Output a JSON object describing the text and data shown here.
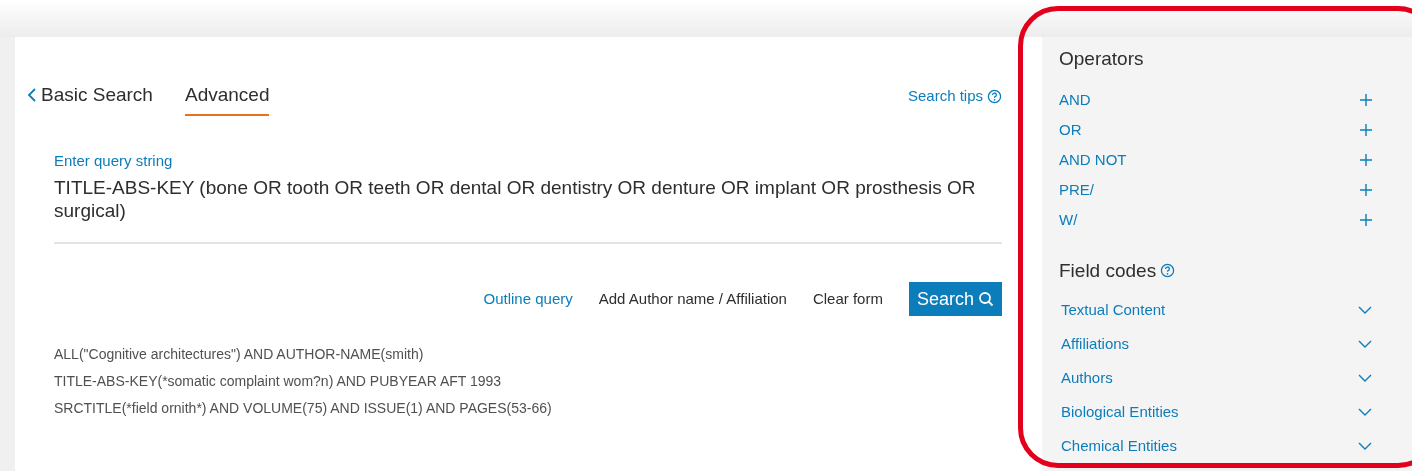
{
  "tabs": [
    {
      "label": "Basic Search",
      "selected": false,
      "kind": "back"
    },
    {
      "label": "Advanced",
      "selected": true,
      "kind": "tab"
    }
  ],
  "search_tips": "Search tips",
  "query": {
    "label": "Enter query string",
    "value": "TITLE-ABS-KEY (bone OR tooth OR teeth OR dental OR dentistry OR denture OR implant OR prosthesis OR surgical)"
  },
  "actions": [
    {
      "label": "Outline query",
      "kind": "link"
    },
    {
      "label": "Add Author name / Affiliation",
      "kind": "plain"
    },
    {
      "label": "Clear form",
      "kind": "plain"
    },
    {
      "label": "Search",
      "kind": "primary"
    }
  ],
  "examples": [
    "ALL(\"Cognitive architectures\") AND AUTHOR-NAME(smith)",
    "TITLE-ABS-KEY(*somatic complaint wom?n) AND PUBYEAR AFT 1993",
    "SRCTITLE(*field ornith*) AND VOLUME(75) AND ISSUE(1) AND PAGES(53-66)"
  ],
  "sidebar": {
    "operators_title": "Operators",
    "operators": [
      "AND",
      "OR",
      "AND NOT",
      "PRE/",
      "W/"
    ],
    "field_codes_title": "Field codes",
    "field_codes": [
      {
        "label": "Textual Content",
        "expanded": false
      },
      {
        "label": "Affiliations",
        "expanded": false
      },
      {
        "label": "Authors",
        "expanded": false
      },
      {
        "label": "Biological Entities",
        "expanded": false
      },
      {
        "label": "Chemical Entities",
        "expanded": false
      }
    ]
  }
}
